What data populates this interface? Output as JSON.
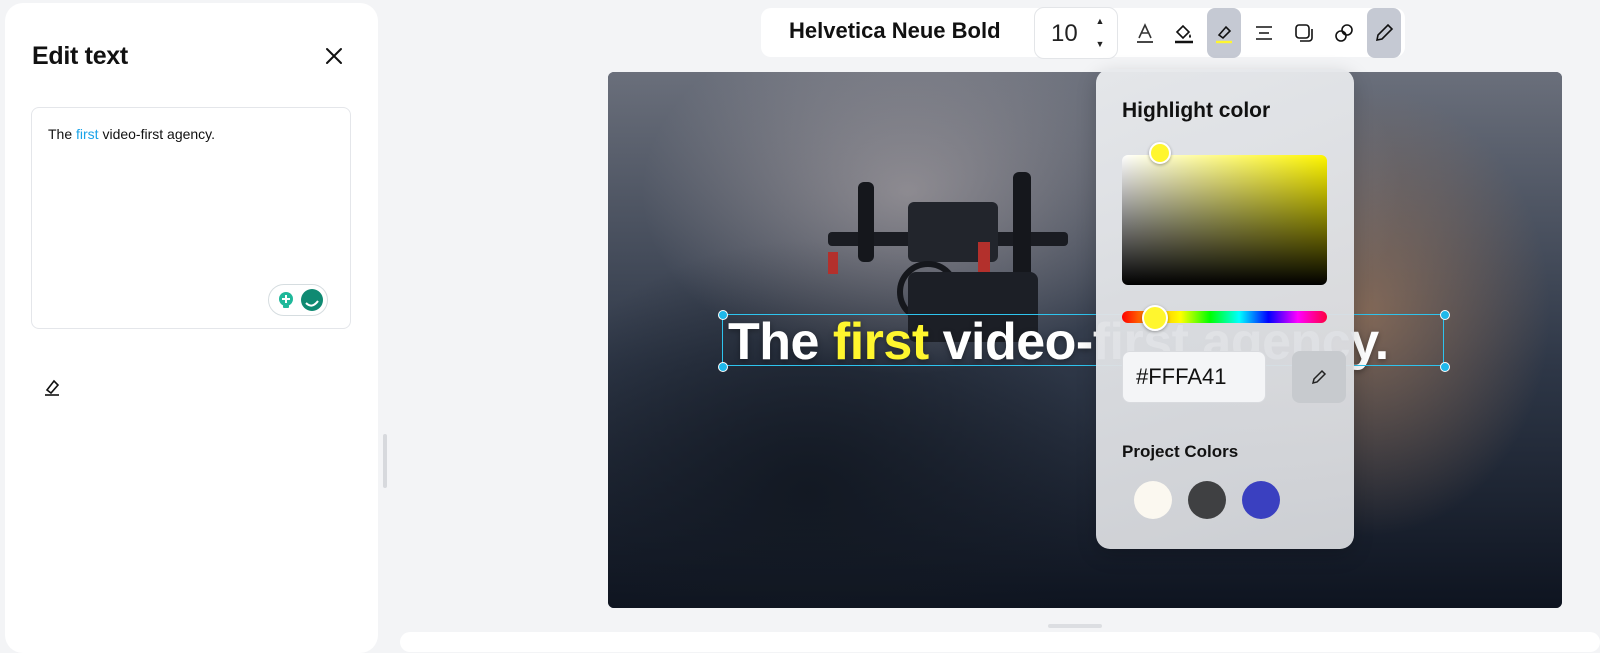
{
  "panel": {
    "title": "Edit text",
    "text_before": "The ",
    "text_highlight": "first",
    "text_after": " video-first agency."
  },
  "toolbar": {
    "font_name": "Helvetica Neue Bold",
    "font_size": "10",
    "icons": [
      "text-color-icon",
      "fill-icon",
      "highlighter-icon",
      "align-icon",
      "shadow-icon",
      "link-icon",
      "edit-pen-icon"
    ]
  },
  "canvas": {
    "caption_before": "The ",
    "caption_highlight": "first",
    "caption_after": " video-first agency."
  },
  "popover": {
    "title": "Highlight color",
    "hex_value": "#FFFA41",
    "project_colors_title": "Project Colors",
    "project_colors": [
      "#fbf8f0",
      "#3f4042",
      "#3a40c0"
    ]
  },
  "colors": {
    "accent_highlight": "#fff62e",
    "selection": "#2ec4ee",
    "panel_text_highlight": "#1aa3e8"
  }
}
